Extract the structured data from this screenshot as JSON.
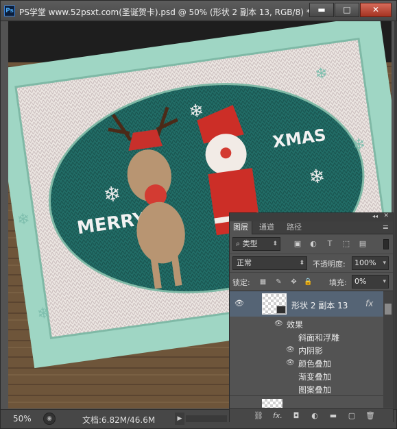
{
  "window": {
    "app_logo": "Ps",
    "title": "PS学堂 www.52psxt.com(圣诞贺卡).psd @ 50% (形状 2 副本 13, RGB/8) *",
    "buttons": {
      "minimize": "▬",
      "maximize": "□",
      "close": "✕"
    }
  },
  "canvas": {
    "artwork": {
      "word_left": "MERRY",
      "word_right": "XMAS"
    }
  },
  "status": {
    "zoom": "50%",
    "doc_info": "文档:6.82M/46.6M"
  },
  "layers_panel": {
    "tabs": [
      "图层",
      "通道",
      "路径"
    ],
    "filter": {
      "label": "类型"
    },
    "blend_mode": "正常",
    "opacity_label": "不透明度:",
    "opacity_value": "100%",
    "lock_label": "锁定:",
    "fill_label": "填充:",
    "fill_value": "0%",
    "selected_layer": {
      "name": "形状 2 副本 13",
      "fx": "fx"
    },
    "effects_label": "效果",
    "effects": [
      {
        "name": "斜面和浮雕",
        "visible": false
      },
      {
        "name": "内阴影",
        "visible": true
      },
      {
        "name": "颜色叠加",
        "visible": true
      },
      {
        "name": "渐变叠加",
        "visible": false
      },
      {
        "name": "图案叠加",
        "visible": false
      }
    ]
  },
  "colors": {
    "ui_dark": "#535353",
    "selected_layer": "#556475",
    "card_mint": "#9fd6c4",
    "knit_teal": "#1f6b66",
    "close_red": "#c24a37"
  }
}
